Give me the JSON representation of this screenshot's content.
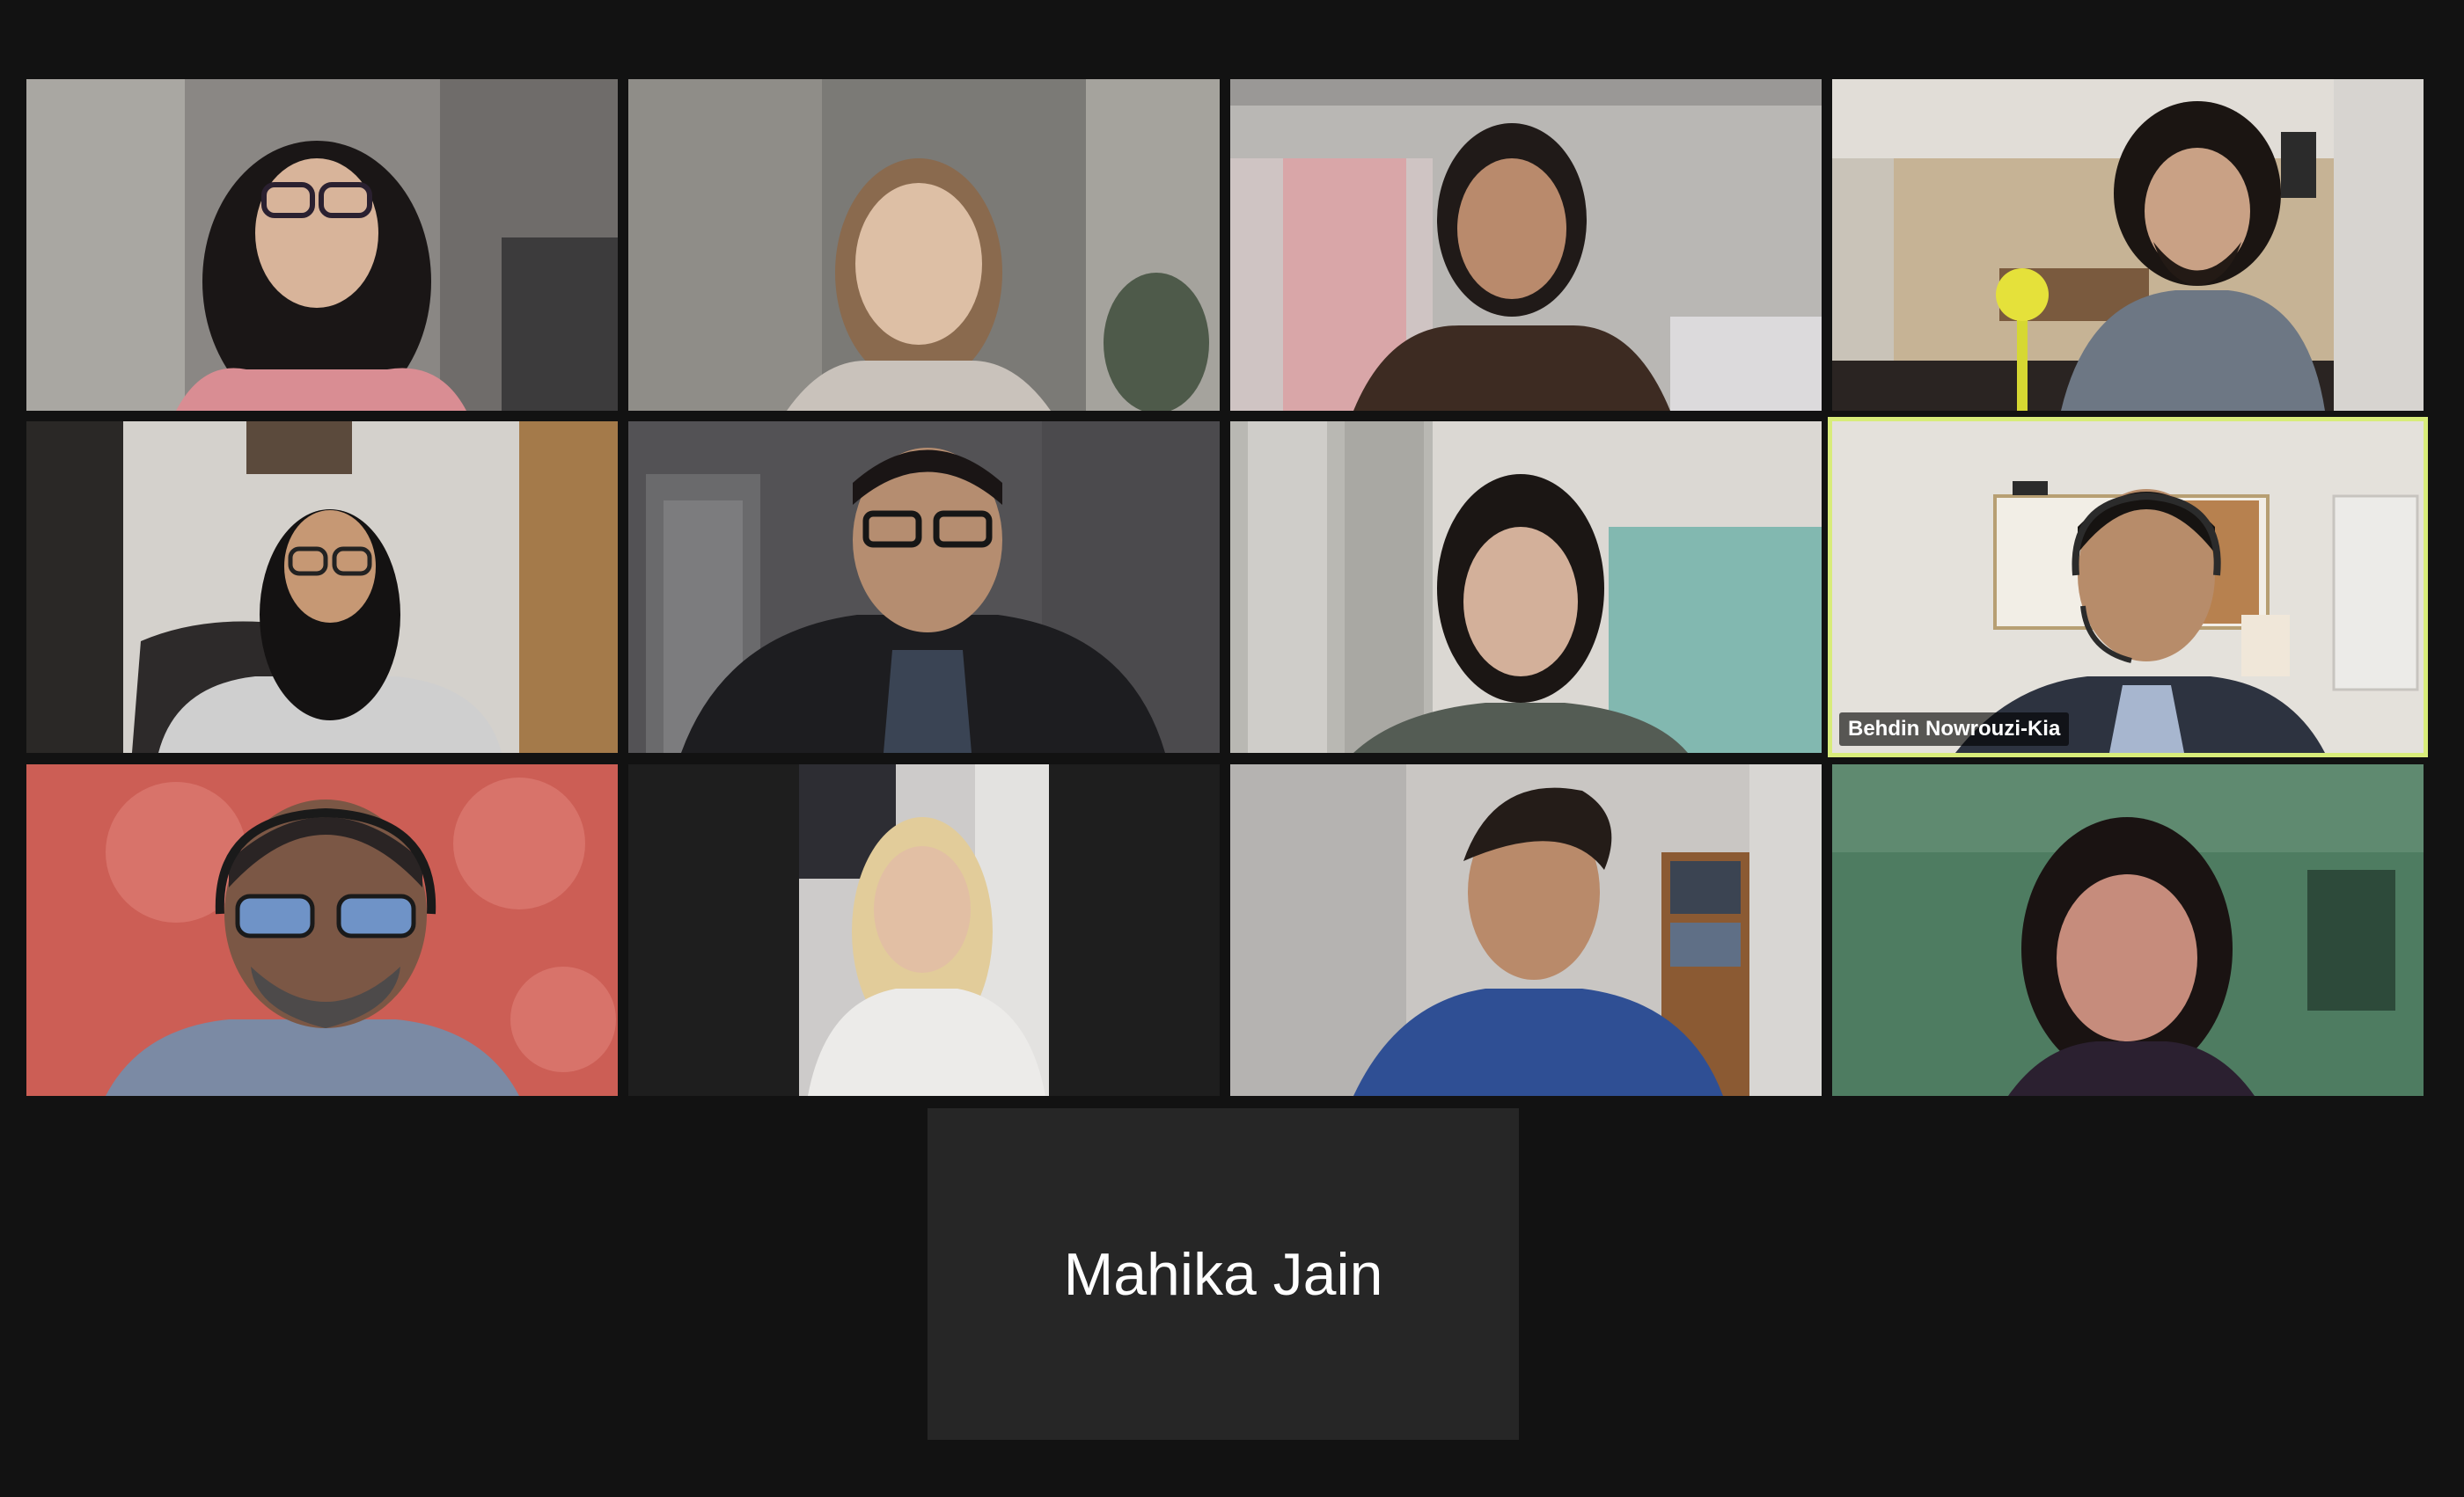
{
  "gallery": {
    "active_speaker_color": "#d8ec7a",
    "tiles": [
      {
        "id": 1,
        "video": true,
        "label": ""
      },
      {
        "id": 2,
        "video": true,
        "label": ""
      },
      {
        "id": 3,
        "video": true,
        "label": ""
      },
      {
        "id": 4,
        "video": true,
        "label": ""
      },
      {
        "id": 5,
        "video": true,
        "label": ""
      },
      {
        "id": 6,
        "video": true,
        "label": ""
      },
      {
        "id": 7,
        "video": true,
        "label": ""
      },
      {
        "id": 8,
        "video": true,
        "label": "Behdin Nowrouzi-Kia",
        "active_speaker": true
      },
      {
        "id": 9,
        "video": true,
        "label": ""
      },
      {
        "id": 10,
        "video": true,
        "label": ""
      },
      {
        "id": 11,
        "video": true,
        "label": ""
      },
      {
        "id": 12,
        "video": true,
        "label": ""
      },
      {
        "id": 13,
        "video": false,
        "label": "Mahika Jain"
      }
    ]
  }
}
